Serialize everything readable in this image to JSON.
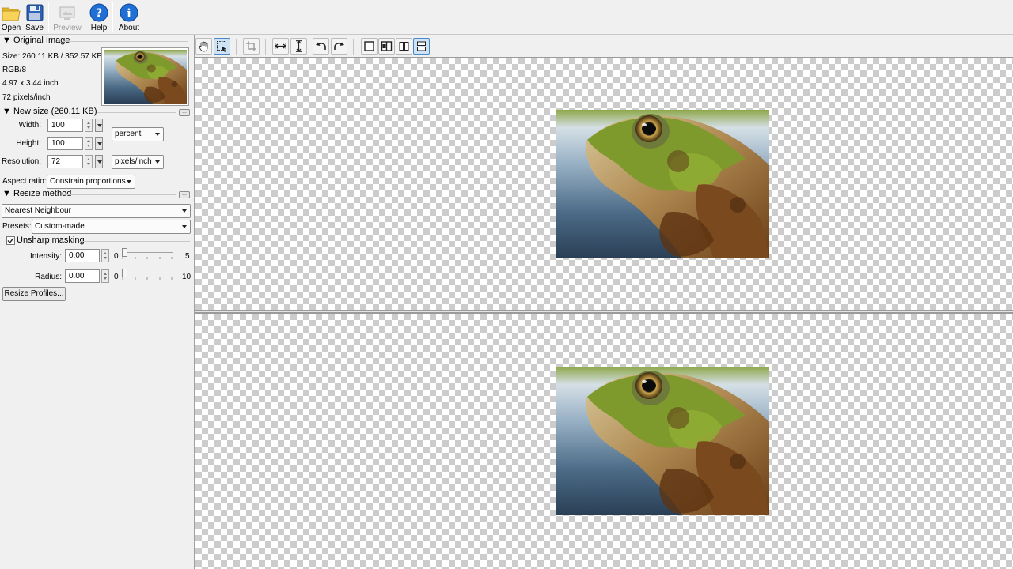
{
  "toolbar": {
    "open_label": "Open",
    "save_label": "Save",
    "preview_label": "Preview",
    "help_label": "Help",
    "about_label": "About"
  },
  "original_image": {
    "header": "Original Image",
    "size": "Size: 260.11 KB / 352.57 KB",
    "color_mode": "RGB/8",
    "dimensions": "4.97 x 3.44 inch",
    "resolution": "72 pixels/inch"
  },
  "new_size": {
    "header": "New size (260.11 KB)",
    "width_label": "Width:",
    "width_value": "100",
    "height_label": "Height:",
    "height_value": "100",
    "size_unit": "percent",
    "resolution_label": "Resolution:",
    "resolution_value": "72",
    "resolution_unit": "pixels/inch",
    "aspect_label": "Aspect ratio:",
    "aspect_value": "Constrain proportions",
    "more_button": "..."
  },
  "resize_method": {
    "header": "Resize method",
    "method": "Nearest Neighbour",
    "presets_label": "Presets:",
    "presets_value": "Custom-made",
    "unsharp_label": "Unsharp masking",
    "unsharp_checked": true,
    "intensity_label": "Intensity:",
    "intensity_value": "0.00",
    "intensity_min": "0",
    "intensity_max": "5",
    "intensity_level": 0,
    "radius_label": "Radius:",
    "radius_value": "0.00",
    "radius_min": "0",
    "radius_max": "10",
    "radius_level": 0,
    "more_button": "...",
    "profiles_button": "Resize Profiles..."
  },
  "icons": {
    "open": "folder-icon",
    "save": "floppy-disk-icon",
    "preview": "preview-icon",
    "help": "question-icon",
    "about": "info-icon",
    "hand": "hand-icon",
    "select": "select-icon",
    "crop": "crop-icon",
    "flip_h": "flip-horizontal-icon",
    "flip_v": "flip-vertical-icon",
    "rotate_left": "rotate-left-icon",
    "rotate_right": "rotate-right-icon",
    "single_view": "single-view-icon",
    "split_mirror": "split-mirror-view-icon",
    "split_vertical": "split-vertical-view-icon",
    "split_horizontal": "split-horizontal-view-icon"
  },
  "colors": {
    "accent": "#1e64c8",
    "active_button": "#cfe3f7"
  }
}
